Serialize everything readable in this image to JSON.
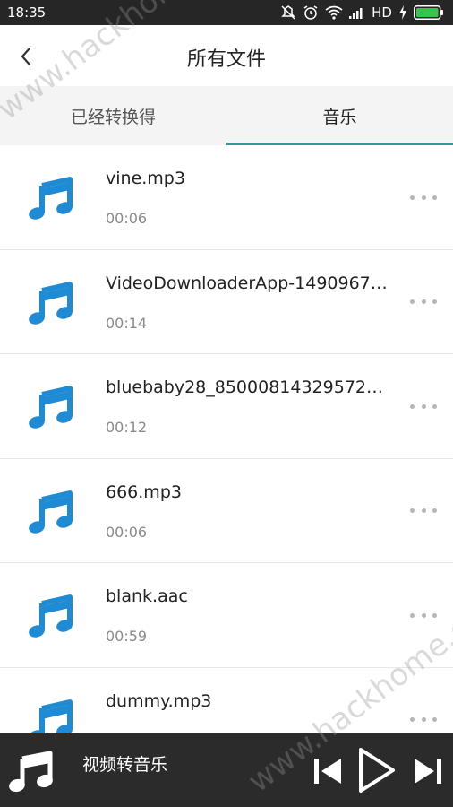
{
  "status_bar": {
    "time": "18:35",
    "network": "HD"
  },
  "header": {
    "title": "所有文件"
  },
  "tabs": [
    {
      "label": "已经转换得",
      "active": false
    },
    {
      "label": "音乐",
      "active": true
    }
  ],
  "files": [
    {
      "name": "vine.mp3",
      "duration": "00:06"
    },
    {
      "name": "VideoDownloaderApp-1490967…",
      "duration": "00:14"
    },
    {
      "name": "bluebaby28_85000814329572…",
      "duration": "00:12"
    },
    {
      "name": "666.mp3",
      "duration": "00:06"
    },
    {
      "name": "blank.aac",
      "duration": "00:59"
    },
    {
      "name": "dummy.mp3",
      "duration": ""
    }
  ],
  "player": {
    "title": "视频转音乐"
  },
  "watermark": {
    "text": "www.hackhome.com"
  },
  "colors": {
    "accent": "#2a9a9b",
    "music_icon": "#1f8bd4",
    "player_bg": "#2b2b2b",
    "status_bg": "#262626"
  },
  "icons": {
    "back": "chevron-left-icon",
    "file": "music-note-icon",
    "more": "more-dots-icon",
    "prev": "skip-previous-icon",
    "play": "play-icon",
    "next": "skip-next-icon"
  }
}
